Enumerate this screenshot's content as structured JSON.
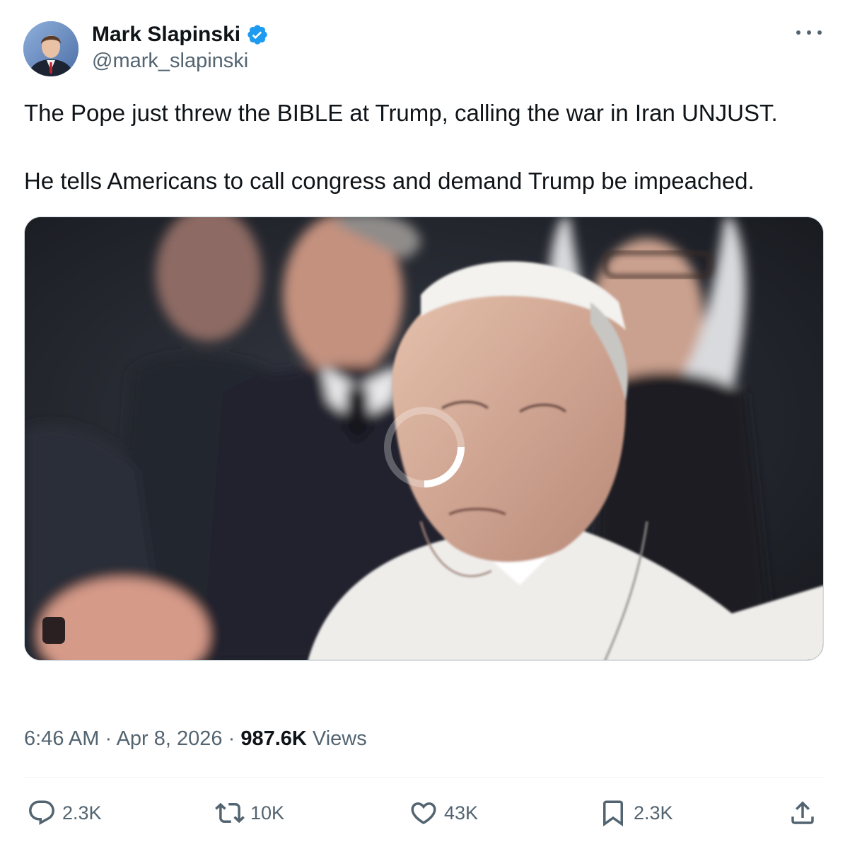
{
  "author": {
    "display_name": "Mark Slapinski",
    "handle": "@mark_slapinski",
    "verified": true
  },
  "tweet": {
    "paragraphs": [
      "The Pope just threw the BIBLE at Trump, calling the war in Iran UNJUST.",
      "He tells Americans to call congress and demand Trump be impeached."
    ]
  },
  "media": {
    "type": "video",
    "state": "loading"
  },
  "meta": {
    "time": "6:46 AM",
    "sep1": " · ",
    "date": "Apr 8, 2026",
    "sep2": " · ",
    "views_count": "987.6K",
    "views_label": " Views"
  },
  "actions": {
    "replies": "2.3K",
    "retweets": "10K",
    "likes": "43K",
    "bookmarks": "2.3K"
  },
  "colors": {
    "verified_badge": "#1d9bf0",
    "secondary_text": "#536471",
    "primary_text": "#0f1419"
  }
}
